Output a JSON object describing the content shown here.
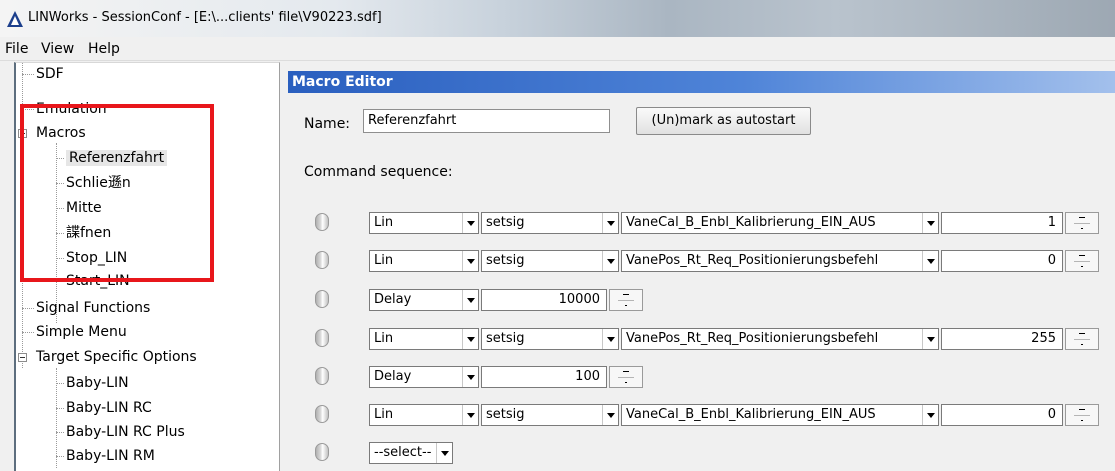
{
  "window": {
    "title": "LINWorks - SessionConf - [E:\\...clients'  file\\V90223.sdf]"
  },
  "menu": [
    "File",
    "View",
    "Help"
  ],
  "tree": {
    "items": [
      {
        "label": "SDF",
        "level": 0
      },
      {
        "label": "Emulation",
        "level": 0
      },
      {
        "label": "Macros",
        "level": 0,
        "expander": true
      },
      {
        "label": "Referenzfahrt",
        "level": 1,
        "selected": true
      },
      {
        "label": "Schlie遜n",
        "level": 1
      },
      {
        "label": "Mitte",
        "level": 1
      },
      {
        "label": "諜fnen",
        "level": 1
      },
      {
        "label": "Stop_LIN",
        "level": 1
      },
      {
        "label": "Start_LIN",
        "level": 1
      },
      {
        "label": "Signal Functions",
        "level": 0
      },
      {
        "label": "Simple Menu",
        "level": 0
      },
      {
        "label": "Target Specific Options",
        "level": 0,
        "expander": true
      },
      {
        "label": "Baby-LIN",
        "level": 1
      },
      {
        "label": "Baby-LIN RC",
        "level": 1
      },
      {
        "label": "Baby-LIN RC Plus",
        "level": 1
      },
      {
        "label": "Baby-LIN RM",
        "level": 1
      }
    ]
  },
  "editor": {
    "header": "Macro Editor",
    "name_label": "Name:",
    "name_value": "Referenzfahrt",
    "autostart_button": "(Un)mark as autostart",
    "sequence_label": "Command sequence:",
    "commands": [
      {
        "type": "Lin",
        "action": "setsig",
        "signal": "VaneCal_B_Enbl_Kalibrierung_EIN_AUS",
        "value": "1"
      },
      {
        "type": "Lin",
        "action": "setsig",
        "signal": "VanePos_Rt_Req_Positionierungsbefehl",
        "value": "0"
      },
      {
        "type": "Delay",
        "value": "10000"
      },
      {
        "type": "Lin",
        "action": "setsig",
        "signal": "VanePos_Rt_Req_Positionierungsbefehl",
        "value": "255"
      },
      {
        "type": "Delay",
        "value": "100"
      },
      {
        "type": "Lin",
        "action": "setsig",
        "signal": "VaneCal_B_Enbl_Kalibrierung_EIN_AUS",
        "value": "0"
      },
      {
        "type": "--select--"
      }
    ]
  },
  "colors": {
    "accent": "#3b6fcf",
    "highlight_border": "#e8161b"
  }
}
